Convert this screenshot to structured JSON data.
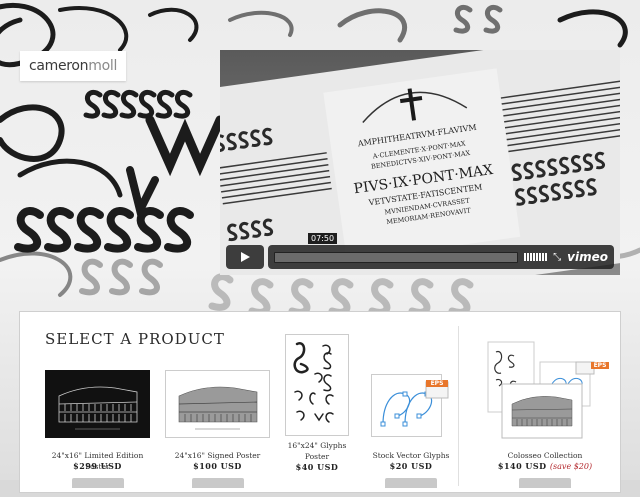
{
  "brand": {
    "part1": "cameron",
    "part2": "moll"
  },
  "video": {
    "timestamp": "07:50",
    "provider": "vimeo",
    "poster_lines": [
      "AMPHITHEATRVM·FLAVIVM",
      "A·CLEMENTE·X·PONT·MAX",
      "BENEDICTVS·XIV·PONT·MAX",
      "PIVS·IX·PONT·MAX",
      "VETVSTATE·FATISCENTEM",
      "MVNIENDAM·CVRASSET",
      "MEMORIAM·RENOVAVIT"
    ]
  },
  "section": {
    "title": "SELECT A PRODUCT"
  },
  "products": [
    {
      "name": "24\"x16\" Limited Edition Poster",
      "price": "$299 USD"
    },
    {
      "name": "24\"x16\" Signed Poster",
      "price": "$100 USD"
    },
    {
      "name": "16\"x24\" Glyphs Poster",
      "price": "$40 USD"
    },
    {
      "name": "Stock Vector Glyphs",
      "price": "$20 USD",
      "badge": "EPS"
    },
    {
      "name": "Colosseo Collection",
      "price": "$140 USD",
      "save": "(save $20)",
      "badge": "EPS"
    }
  ],
  "colors": {
    "accent_red": "#b3282d",
    "badge_orange": "#e8762b",
    "vector_blue": "#3b8fd9"
  }
}
